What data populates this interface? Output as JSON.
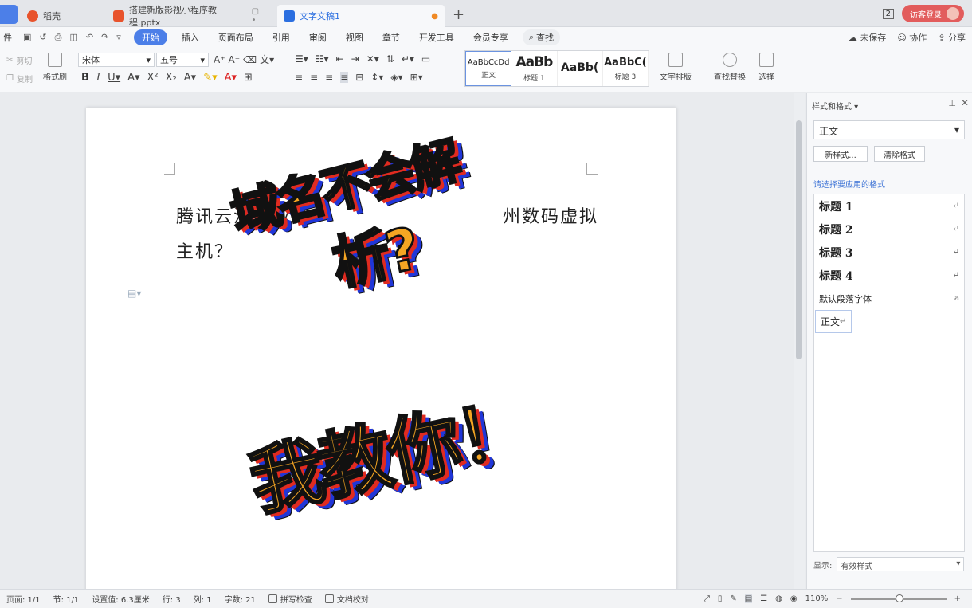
{
  "tabs": [
    {
      "label": "稻壳",
      "color": "#e8532c"
    },
    {
      "label": "搭建新版影视小程序教程.pptx",
      "color": "#e8532c"
    },
    {
      "label": "文字文稿1",
      "color": "#2c6fe0"
    }
  ],
  "tab_indicator": "2",
  "login_label": "访客登录",
  "menu": {
    "file": "件",
    "items": [
      "开始",
      "插入",
      "页面布局",
      "引用",
      "审阅",
      "视图",
      "章节",
      "开发工具",
      "会员专享"
    ],
    "search": "查找",
    "right": [
      "未保存",
      "协作",
      "分享"
    ]
  },
  "ribbon": {
    "cut": "剪切",
    "copy": "复制",
    "format_painter": "格式刷",
    "font": "宋体",
    "size": "五号",
    "styles": [
      {
        "preview": "AaBbCcDd",
        "label": "正文"
      },
      {
        "preview": "AaBb",
        "label": "标题 1"
      },
      {
        "preview": "AaBb(",
        "label": ""
      },
      {
        "preview": "AaBbC(",
        "label": "标题 3"
      }
    ],
    "text_layout": "文字排版",
    "find_replace": "查找替换",
    "select": "选择"
  },
  "document": {
    "text_line1": "腾讯云注册域名",
    "text_line1_b": "州数码虚拟",
    "text_line2": "主机？",
    "overlay1": "域名不会解",
    "overlay2": "析?",
    "overlay3": "我教你！"
  },
  "panel": {
    "title": "样式和格式",
    "current": "正文",
    "new_style": "新样式...",
    "clear_format": "清除格式",
    "hint": "请选择要应用的格式",
    "items": [
      {
        "label": "标题 1",
        "kind": "h"
      },
      {
        "label": "标题 2",
        "kind": "h"
      },
      {
        "label": "标题 3",
        "kind": "h"
      },
      {
        "label": "标题 4",
        "kind": "h"
      },
      {
        "label": "默认段落字体",
        "kind": "n"
      },
      {
        "label": "正文",
        "kind": "sel"
      }
    ],
    "show_label": "显示:",
    "show_value": "有效样式"
  },
  "status": {
    "page": "页面: 1/1",
    "section": "节: 1/1",
    "position": "设置值: 6.3厘米",
    "row": "行: 3",
    "col": "列: 1",
    "words": "字数: 21",
    "spell": "拼写检查",
    "proof": "文档校对",
    "zoom": "110%"
  }
}
